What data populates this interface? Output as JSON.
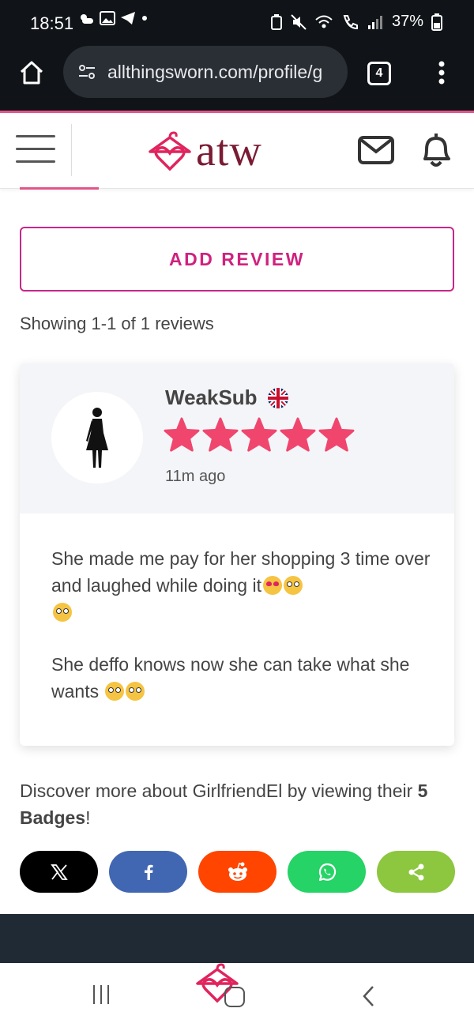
{
  "status_bar": {
    "time": "18:51",
    "battery": "37%"
  },
  "browser": {
    "url": "allthingsworn.com/profile/g",
    "tab_count": "4"
  },
  "header": {
    "logo_text": "atw"
  },
  "add_review_label": "ADD REVIEW",
  "showing_text": "Showing 1-1 of 1 reviews",
  "review": {
    "username": "WeakSub",
    "stars": 5,
    "time_ago": "11m ago",
    "paragraph1": "She made me pay for her shopping 3 time over and laughed while doing it",
    "paragraph2": "She deffo knows now she can take what she wants "
  },
  "discover": {
    "prefix": "Discover more about GirlfriendEl by viewing their ",
    "badges": "5 Badges",
    "suffix": "!"
  },
  "share": [
    {
      "name": "x",
      "color": "#000000"
    },
    {
      "name": "facebook",
      "color": "#4267b2"
    },
    {
      "name": "reddit",
      "color": "#ff4500"
    },
    {
      "name": "whatsapp",
      "color": "#25d366"
    },
    {
      "name": "share",
      "color": "#8dc63f"
    }
  ],
  "colors": {
    "brand": "#7a1b34",
    "accent": "#d0217f",
    "star": "#f0466e"
  }
}
